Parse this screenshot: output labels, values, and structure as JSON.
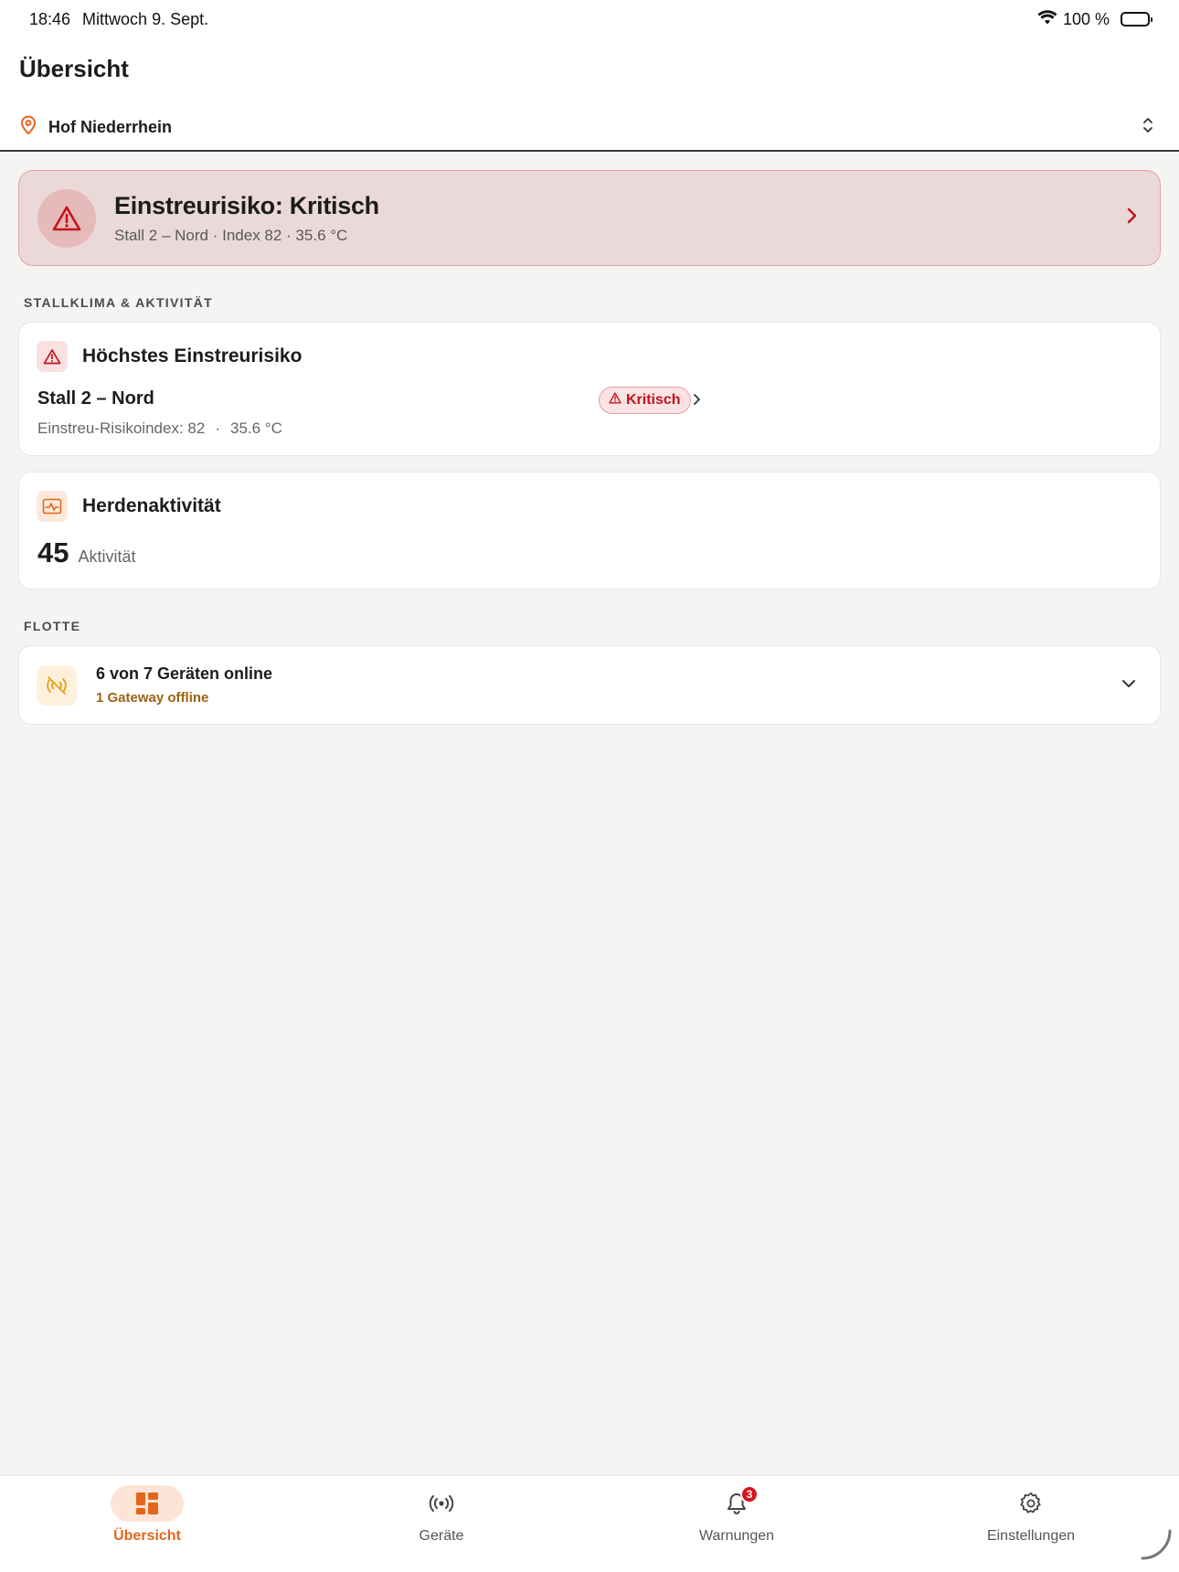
{
  "status_bar": {
    "time": "18:46",
    "date": "Mittwoch 9. Sept.",
    "battery": "100 %"
  },
  "header": {
    "title": "Übersicht",
    "farm": "Hof Niederrhein"
  },
  "alert": {
    "title": "Einstreurisiko: Kritisch",
    "subtitle": "Stall 2 – Nord · Index 82 · 35.6 °C"
  },
  "sections": {
    "climate": "STALLKLIMA & AKTIVITÄT",
    "fleet": "FLOTTE"
  },
  "risk_card": {
    "title": "Höchstes Einstreurisiko",
    "stall": "Stall 2 – Nord",
    "badge": "Kritisch",
    "index_label": "Einstreu-Risikoindex: 82",
    "separator": "·",
    "temperature": "35.6 °C"
  },
  "herd_card": {
    "title": "Herdenaktivität",
    "value": "45",
    "unit": "Aktivität"
  },
  "fleet_card": {
    "summary": "6 von 7 Geräten online",
    "detail": "1 Gateway offline"
  },
  "tabs": [
    {
      "label": "Übersicht",
      "icon": "dashboard-icon",
      "active": true
    },
    {
      "label": "Geräte",
      "icon": "broadcast-icon",
      "active": false
    },
    {
      "label": "Warnungen",
      "icon": "bell-icon",
      "active": false,
      "badge": "3"
    },
    {
      "label": "Einstellungen",
      "icon": "gear-icon",
      "active": false
    }
  ],
  "colors": {
    "accent": "#e4661a",
    "critical": "#c0141b",
    "warning_text": "#9a6412"
  }
}
